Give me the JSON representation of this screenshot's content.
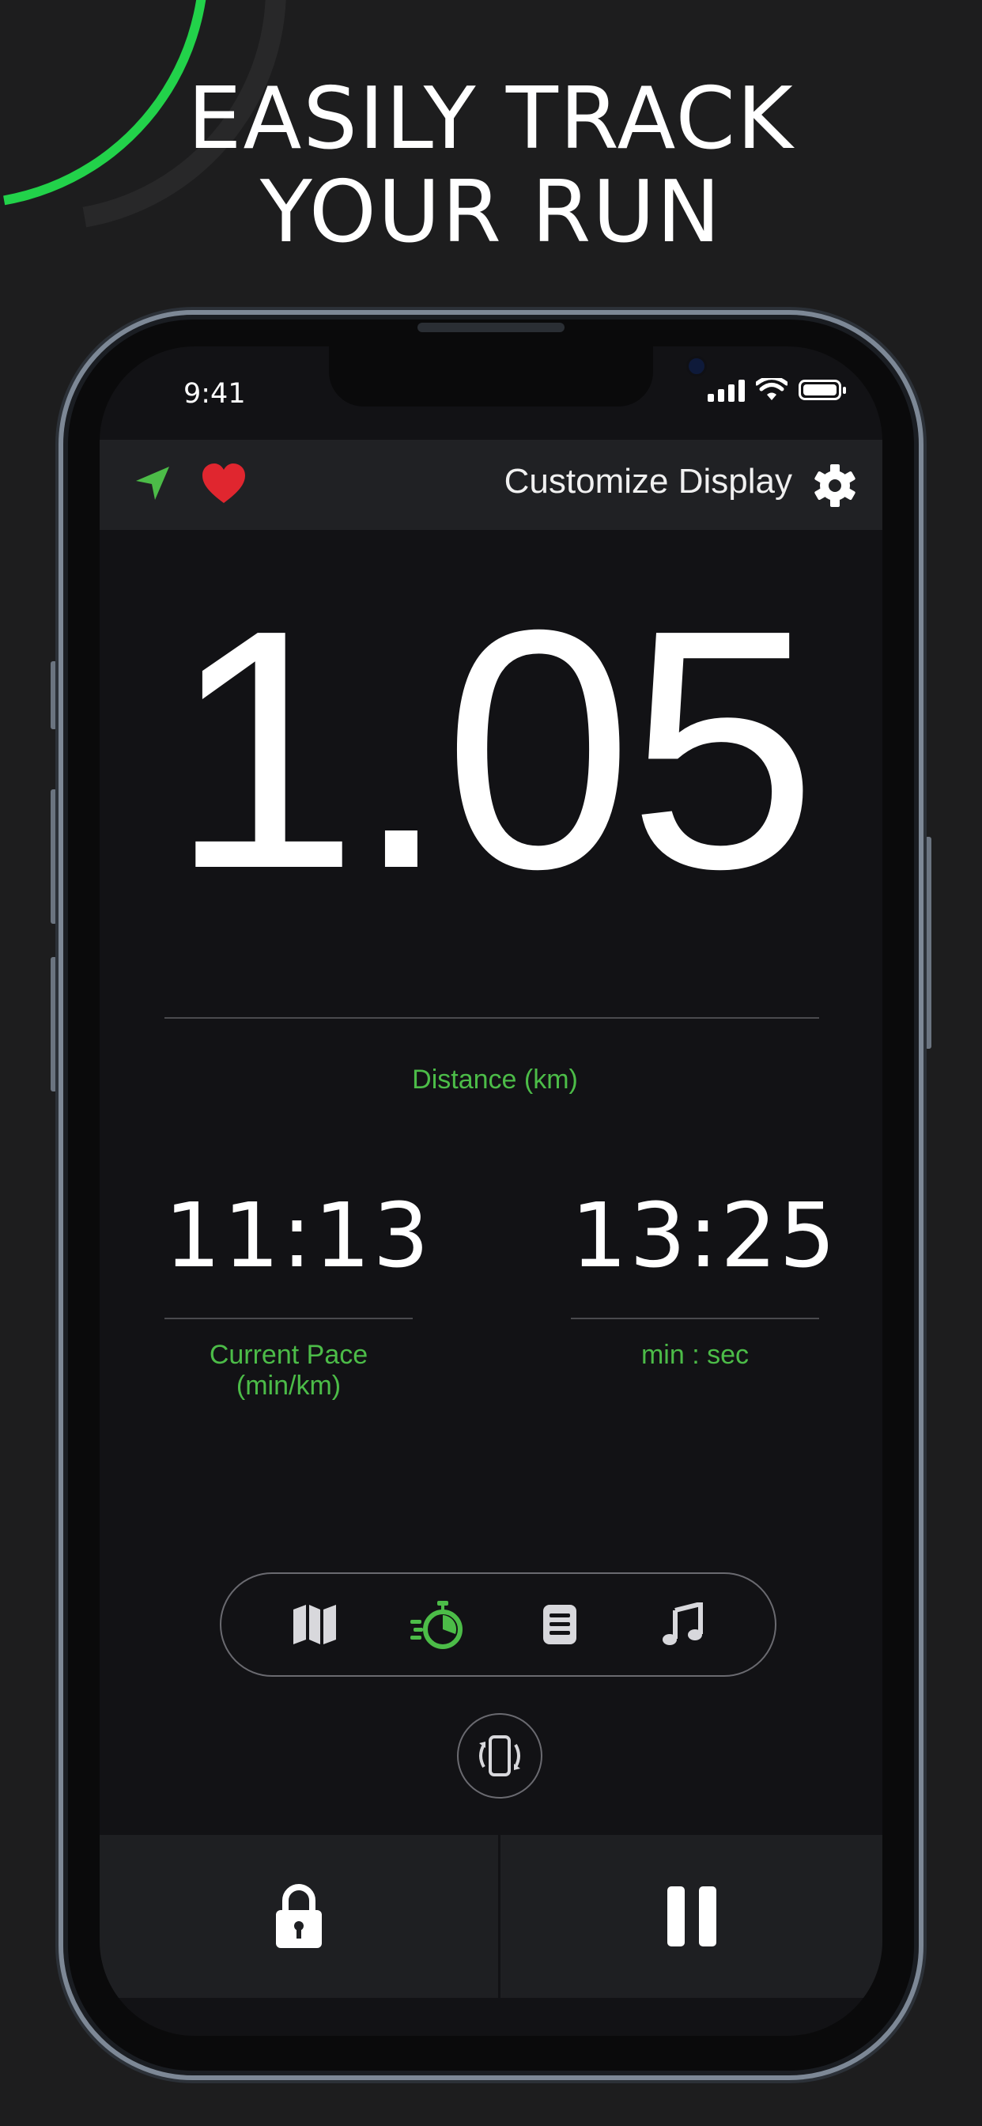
{
  "headline": {
    "line1": "EASILY TRACK",
    "line2": "YOUR RUN"
  },
  "status_bar": {
    "time": "9:41"
  },
  "topbar": {
    "customize_label": "Customize Display"
  },
  "distance": {
    "value": "1.05",
    "label": "Distance (km)"
  },
  "pace": {
    "value": "11:13",
    "label": "Current Pace (min/km)"
  },
  "duration": {
    "value": "13:25",
    "label": "min : sec"
  },
  "nav": {
    "tabs": [
      {
        "icon": "map-icon",
        "active": false
      },
      {
        "icon": "stopwatch-icon",
        "active": true
      },
      {
        "icon": "list-icon",
        "active": false
      },
      {
        "icon": "music-note-icon",
        "active": false
      }
    ]
  },
  "colors": {
    "accent": "#4cbc48",
    "arc": "#22d24a",
    "heart": "#e0262f",
    "background": "#121215"
  }
}
